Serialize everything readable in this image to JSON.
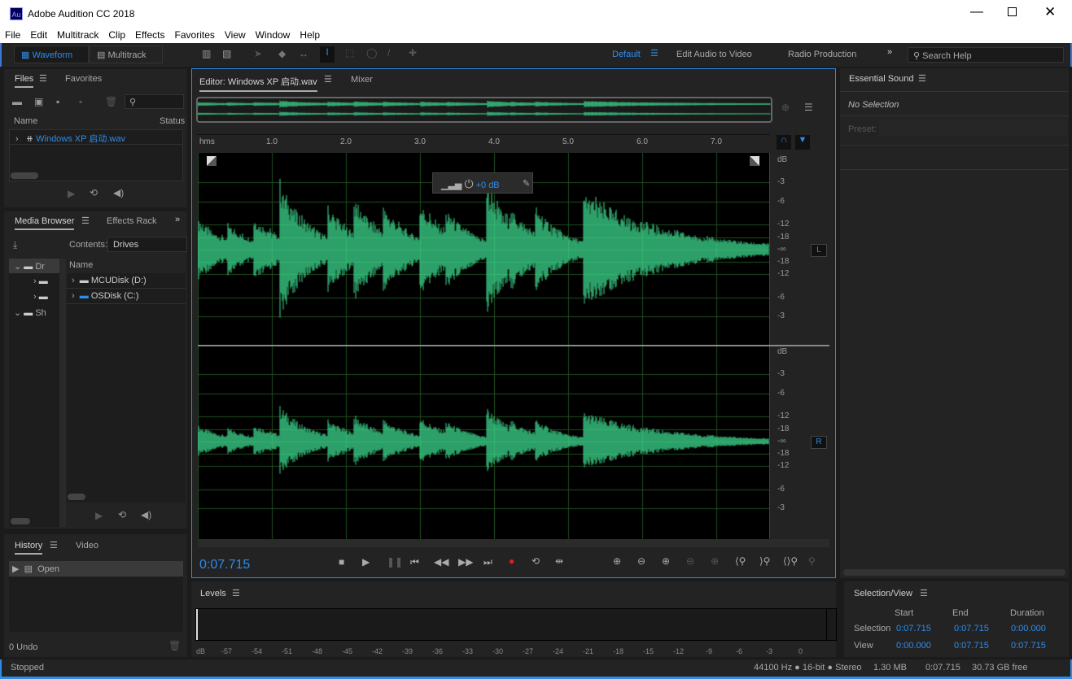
{
  "window": {
    "title": "Adobe Audition CC 2018",
    "app_icon": "Au"
  },
  "menu": [
    "File",
    "Edit",
    "Multitrack",
    "Clip",
    "Effects",
    "Favorites",
    "View",
    "Window",
    "Help"
  ],
  "toolbar": {
    "waveform": "Waveform",
    "multitrack": "Multitrack",
    "workspaces": [
      "Default",
      "Edit Audio to Video",
      "Radio Production"
    ],
    "search_placeholder": "Search Help"
  },
  "files": {
    "tabs": [
      "Files",
      "Favorites"
    ],
    "col_name": "Name",
    "col_status": "Status",
    "items": [
      "Windows XP 启动.wav"
    ]
  },
  "media": {
    "tabs": [
      "Media Browser",
      "Effects Rack"
    ],
    "contents_label": "Contents:",
    "contents_value": "Drives",
    "tree": [
      "Dr",
      "Sh"
    ],
    "col_name": "Name",
    "items": [
      "MCUDisk (D:)",
      "OSDisk (C:)"
    ]
  },
  "history": {
    "tabs": [
      "History",
      "Video"
    ],
    "items": [
      "Open"
    ],
    "undo": "0 Undo"
  },
  "editor": {
    "tabs": [
      "Editor: Windows XP 启动.wav",
      "Mixer"
    ],
    "ruler_unit": "hms",
    "ticks": [
      "1.0",
      "2.0",
      "3.0",
      "4.0",
      "5.0",
      "6.0",
      "7.0"
    ],
    "gain": "+0 dB",
    "db_labels": [
      "dB",
      "-3",
      "-6",
      "-12",
      "-18",
      "-∞",
      "-18",
      "-12",
      "-6",
      "-3"
    ],
    "channels": [
      "L",
      "R"
    ],
    "time": "0:07.715",
    "waveform_color": "#3dd68c"
  },
  "essential": {
    "title": "Essential Sound",
    "no_selection": "No Selection",
    "preset_label": "Preset:"
  },
  "levels": {
    "title": "Levels",
    "scale": [
      "dB",
      "-57",
      "-54",
      "-51",
      "-48",
      "-45",
      "-42",
      "-39",
      "-36",
      "-33",
      "-30",
      "-27",
      "-24",
      "-21",
      "-18",
      "-15",
      "-12",
      "-9",
      "-6",
      "-3",
      "0"
    ]
  },
  "selection_view": {
    "title": "Selection/View",
    "headers": [
      "Start",
      "End",
      "Duration"
    ],
    "rows": [
      {
        "label": "Selection",
        "start": "0:07.715",
        "end": "0:07.715",
        "duration": "0:00.000"
      },
      {
        "label": "View",
        "start": "0:00.000",
        "end": "0:07.715",
        "duration": "0:07.715"
      }
    ]
  },
  "status": {
    "state": "Stopped",
    "format": "44100 Hz ● 16-bit ● Stereo",
    "size": "1.30 MB",
    "duration": "0:07.715",
    "free": "30.73 GB free"
  }
}
